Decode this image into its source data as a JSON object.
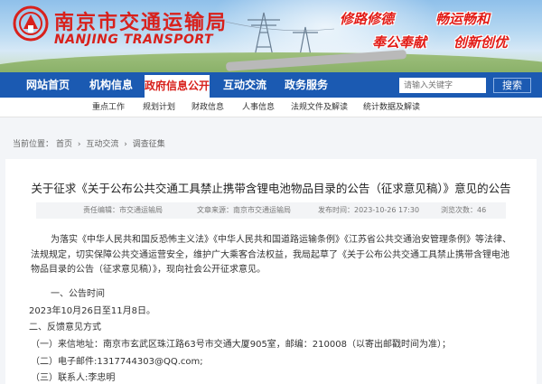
{
  "header": {
    "title": "南京市交通运输局",
    "subtitle": "NANJING TRANSPORT",
    "slogans": [
      "修路修德",
      "畅运畅和",
      "奉公奉献",
      "创新创优"
    ],
    "logo_icon": "nanjing-transport-logo-icon"
  },
  "nav": {
    "items": [
      "网站首页",
      "机构信息",
      "政府信息公开",
      "互动交流",
      "政务服务"
    ],
    "active_index": 2,
    "search_placeholder": "请输入关键字",
    "search_label": "搜索"
  },
  "subnav": {
    "items": [
      "重点工作",
      "规划计划",
      "财政信息",
      "人事信息",
      "法规文件及解读",
      "统计数据及解读"
    ]
  },
  "breadcrumb": {
    "label": "当前位置：",
    "items": [
      "首页",
      "互动交流",
      "调查征集"
    ],
    "separator": "›"
  },
  "article": {
    "title": "关于征求《关于公布公共交通工具禁止携带含锂电池物品目录的公告（征求意见稿）》意见的公告",
    "meta": {
      "editor": "责任编辑：市交通运输局",
      "source": "文章来源：南京市交通运输局",
      "time": "发布时间：2023-10-26 17:30",
      "views": "浏览次数：46"
    },
    "intro": "为落实《中华人民共和国反恐怖主义法》《中华人民共和国道路运输条例》《江苏省公共交通治安管理条例》等法律、法规规定，切实保障公共交通运营安全，维护广大乘客合法权益，我局起草了《关于公布公共交通工具禁止携带含锂电池物品目录的公告（征求意见稿）》，现向社会公开征求意见。",
    "section1": "一、公告时间",
    "date_range": "2023年10月26日至11月8日。",
    "section2": "二、反馈意见方式",
    "item1": "（一）来信地址：南京市玄武区珠江路63号市交通大厦905室，邮编：210008（以寄出邮戳时间为准）；",
    "item2": "（二）电子邮件:1317744303@QQ.com;",
    "item3": "（三）联系人:李忠明"
  },
  "colors": {
    "brand_red": "#d8211c",
    "nav_blue": "#1b5ab2"
  }
}
